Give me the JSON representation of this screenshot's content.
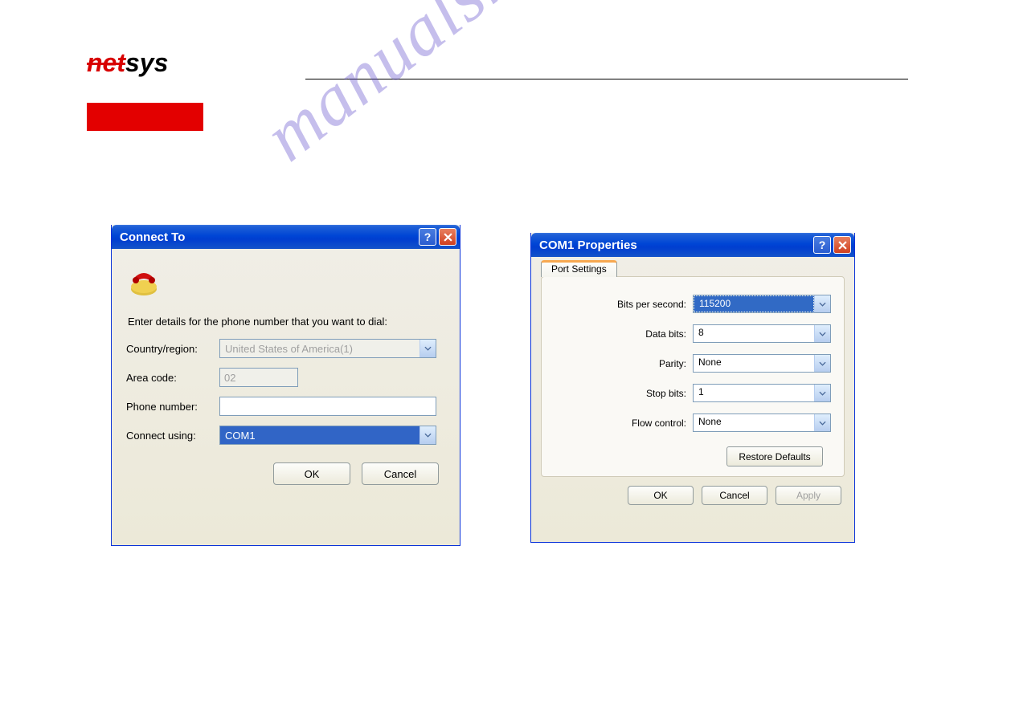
{
  "logo": {
    "net": "net",
    "sys": "sys"
  },
  "watermark": "manualshive.com",
  "connect": {
    "title": "Connect To",
    "instruction": "Enter details for the phone number that you want to dial:",
    "labels": {
      "country": "Country/region:",
      "area": "Area code:",
      "phone": "Phone number:",
      "using": "Connect using:"
    },
    "values": {
      "country": "United States of America(1)",
      "area": "02",
      "phone": "",
      "using": "COM1"
    },
    "buttons": {
      "ok": "OK",
      "cancel": "Cancel"
    }
  },
  "com": {
    "title": "COM1 Properties",
    "tab": "Port Settings",
    "labels": {
      "bps": "Bits per second:",
      "databits": "Data bits:",
      "parity": "Parity:",
      "stopbits": "Stop bits:",
      "flow": "Flow control:"
    },
    "values": {
      "bps": "115200",
      "databits": "8",
      "parity": "None",
      "stopbits": "1",
      "flow": "None"
    },
    "buttons": {
      "restore": "Restore Defaults",
      "ok": "OK",
      "cancel": "Cancel",
      "apply": "Apply"
    }
  }
}
